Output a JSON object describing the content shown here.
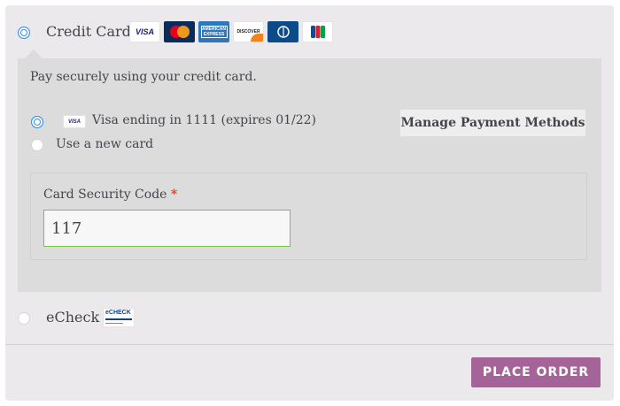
{
  "payment_methods": {
    "credit_card": {
      "label": "Credit Card",
      "selected": true,
      "card_logos": [
        "visa-logo",
        "mastercard-logo",
        "amex-logo",
        "discover-logo",
        "diners-club-logo",
        "jcb-logo"
      ],
      "logo_text": {
        "visa": "VISA",
        "mastercard": "MasterCard",
        "amex": "AMERICAN EXPRESS",
        "discover": "DISCOVER"
      },
      "description": "Pay securely using your credit card.",
      "saved_card": {
        "brand_badge": "VISA",
        "label": "Visa ending in 1111 (expires 01/22)",
        "selected": true
      },
      "new_card_label": "Use a new card",
      "manage_button": "Manage Payment Methods",
      "security_code": {
        "label": "Card Security Code",
        "required_marker": "*",
        "value": "117"
      }
    },
    "echeck": {
      "label": "eCheck",
      "selected": false,
      "logo_text": "eCHECK"
    }
  },
  "place_order_button": "PLACE ORDER",
  "colors": {
    "accent_radio": "#2e8ef2",
    "place_order_bg": "#a46497",
    "input_border": "#7ac142",
    "required": "#e2401c"
  }
}
